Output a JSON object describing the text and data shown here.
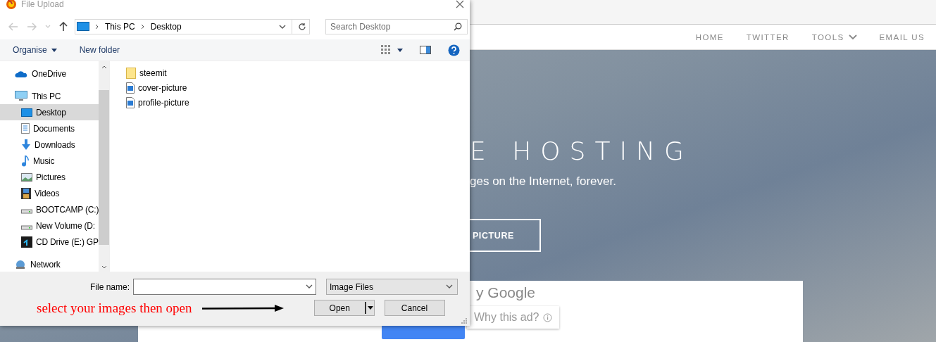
{
  "dialog": {
    "title": "File Upload",
    "breadcrumbs": [
      "This PC",
      "Desktop"
    ],
    "search": {
      "placeholder": "Search Desktop"
    },
    "toolbar": {
      "organise": "Organise",
      "new_folder": "New folder"
    },
    "nav": [
      {
        "label": "OneDrive",
        "kind": "cloud",
        "selected": false
      },
      {
        "label": "This PC",
        "kind": "pc",
        "selected": false,
        "children": [
          {
            "label": "Desktop",
            "kind": "desktop",
            "selected": true
          },
          {
            "label": "Documents",
            "kind": "documents",
            "selected": false
          },
          {
            "label": "Downloads",
            "kind": "downloads",
            "selected": false
          },
          {
            "label": "Music",
            "kind": "music",
            "selected": false
          },
          {
            "label": "Pictures",
            "kind": "pictures",
            "selected": false
          },
          {
            "label": "Videos",
            "kind": "videos",
            "selected": false
          },
          {
            "label": "BOOTCAMP (C:)",
            "kind": "drive",
            "selected": false
          },
          {
            "label": "New Volume (D:",
            "kind": "drive",
            "selected": false
          },
          {
            "label": "CD Drive (E:) GP",
            "kind": "cd",
            "selected": false
          }
        ]
      },
      {
        "label": "Network",
        "kind": "network",
        "selected": false
      }
    ],
    "files": [
      {
        "name": "steemit",
        "kind": "folder"
      },
      {
        "name": "cover-picture",
        "kind": "image"
      },
      {
        "name": "profile-picture",
        "kind": "image"
      }
    ],
    "file_name_label": "File name:",
    "file_type": "Image Files",
    "annotation": "select your images then open",
    "open_button": "Open",
    "cancel_button": "Cancel"
  },
  "page": {
    "nav": [
      {
        "label": "HOME",
        "dropdown": false
      },
      {
        "label": "TWITTER",
        "dropdown": false
      },
      {
        "label": "TOOLS",
        "dropdown": true
      },
      {
        "label": "EMAIL US",
        "dropdown": false
      }
    ],
    "hero_title": "E HOSTING",
    "hero_subtitle": "ges on the Internet, forever.",
    "hero_button": "PICTURE",
    "ad": {
      "by": "y Google",
      "why": "Why this ad?"
    }
  }
}
